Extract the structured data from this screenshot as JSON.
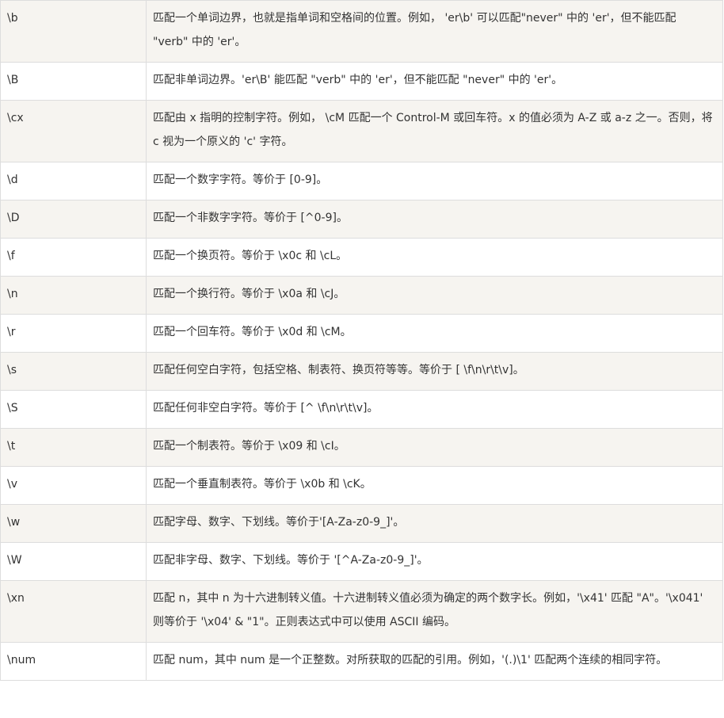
{
  "table": {
    "rows": [
      {
        "char": "\\b",
        "desc": "匹配一个单词边界，也就是指单词和空格间的位置。例如， 'er\\b' 可以匹配\"never\" 中的 'er'，但不能匹配 \"verb\" 中的 'er'。"
      },
      {
        "char": "\\B",
        "desc": "匹配非单词边界。'er\\B' 能匹配 \"verb\" 中的 'er'，但不能匹配 \"never\" 中的 'er'。"
      },
      {
        "char": "\\cx",
        "desc": "匹配由 x 指明的控制字符。例如， \\cM 匹配一个 Control-M 或回车符。x 的值必须为 A-Z 或 a-z 之一。否则，将 c 视为一个原义的 'c' 字符。"
      },
      {
        "char": "\\d",
        "desc": "匹配一个数字字符。等价于 [0-9]。"
      },
      {
        "char": "\\D",
        "desc": "匹配一个非数字字符。等价于 [^0-9]。"
      },
      {
        "char": "\\f",
        "desc": "匹配一个换页符。等价于 \\x0c 和 \\cL。"
      },
      {
        "char": "\\n",
        "desc": "匹配一个换行符。等价于 \\x0a 和 \\cJ。"
      },
      {
        "char": "\\r",
        "desc": "匹配一个回车符。等价于 \\x0d 和 \\cM。"
      },
      {
        "char": "\\s",
        "desc": "匹配任何空白字符，包括空格、制表符、换页符等等。等价于 [ \\f\\n\\r\\t\\v]。"
      },
      {
        "char": "\\S",
        "desc": "匹配任何非空白字符。等价于 [^ \\f\\n\\r\\t\\v]。"
      },
      {
        "char": "\\t",
        "desc": "匹配一个制表符。等价于 \\x09 和 \\cI。"
      },
      {
        "char": "\\v",
        "desc": "匹配一个垂直制表符。等价于 \\x0b 和 \\cK。"
      },
      {
        "char": "\\w",
        "desc": "匹配字母、数字、下划线。等价于'[A-Za-z0-9_]'。"
      },
      {
        "char": "\\W",
        "desc": "匹配非字母、数字、下划线。等价于 '[^A-Za-z0-9_]'。"
      },
      {
        "char": "\\xn",
        "desc": "匹配 n，其中 n 为十六进制转义值。十六进制转义值必须为确定的两个数字长。例如，'\\x41' 匹配 \"A\"。'\\x041' 则等价于 '\\x04' & \"1\"。正则表达式中可以使用 ASCII 编码。"
      },
      {
        "char": "\\num",
        "desc": "匹配 num，其中 num 是一个正整数。对所获取的匹配的引用。例如，'(.)\\1' 匹配两个连续的相同字符。"
      }
    ]
  }
}
